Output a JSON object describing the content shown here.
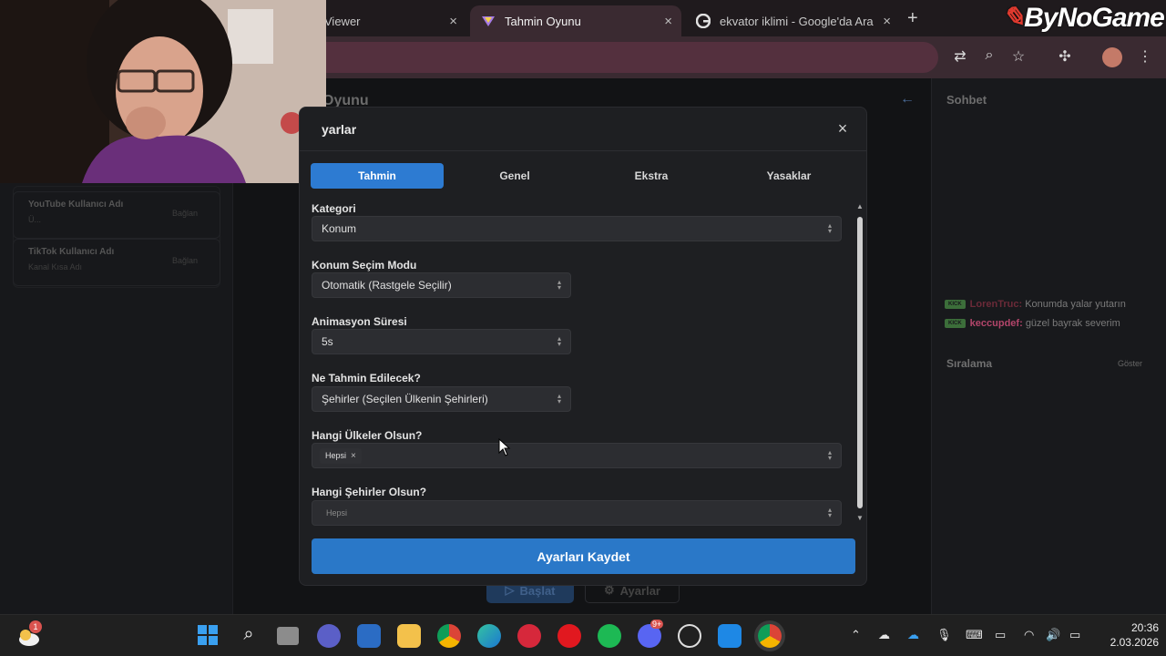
{
  "browser": {
    "tabs": [
      {
        "title": "Viewer",
        "active": false
      },
      {
        "title": "Tahmin Oyunu",
        "active": true
      },
      {
        "title": "ekvator iklimi - Google'da Ara",
        "active": false
      }
    ],
    "new_tab": "+",
    "close_glyph": "×",
    "brand_text": "ByNoGame",
    "toolbar_icons": [
      "translate-icon",
      "zoom-icon",
      "star-icon",
      "extensions-icon",
      "profile-avatar",
      "menu-icon"
    ]
  },
  "page": {
    "title_partial": "Oyunu",
    "cards": [
      {
        "label": "YouTube Kullanıcı Adı",
        "value": "Ü...",
        "action": "Bağlan"
      },
      {
        "label": "TikTok Kullanıcı Adı",
        "value": "Kanal Kısa Adı",
        "action": "Bağlan"
      }
    ],
    "buttons": {
      "start": "Başlat",
      "settings": "Ayarlar"
    }
  },
  "sidebar": {
    "chat_title": "Sohbet",
    "messages": [
      {
        "badge": "KICK",
        "user": "LorenTruc:",
        "text": "Konumda yalar yutarın",
        "user_color": "#6b2a38"
      },
      {
        "badge": "KICK",
        "user": "keccupdef:",
        "text": "güzel bayrak severim",
        "user_color": "#b2456a"
      }
    ],
    "ranking_title": "Sıralama",
    "ranking_show": "Göster"
  },
  "modal": {
    "title": "yarlar",
    "close": "×",
    "tabs": [
      {
        "label": "Tahmin",
        "active": true
      },
      {
        "label": "Genel",
        "active": false
      },
      {
        "label": "Ekstra",
        "active": false
      },
      {
        "label": "Yasaklar",
        "active": false
      }
    ],
    "fields": {
      "kategori": {
        "label": "Kategori",
        "value": "Konum"
      },
      "mode": {
        "label": "Konum Seçim Modu",
        "value": "Otomatik (Rastgele Seçilir)"
      },
      "anim": {
        "label": "Animasyon Süresi",
        "value": "5s"
      },
      "guess": {
        "label": "Ne Tahmin Edilecek?",
        "value": "Şehirler (Seçilen Ülkenin Şehirleri)"
      },
      "countries": {
        "label": "Hangi Ülkeler Olsun?",
        "chip": "Hepsi",
        "chip_remove": "×"
      },
      "cities": {
        "label": "Hangi Şehirler Olsun?",
        "placeholder": "Hepsi"
      }
    },
    "save_label": "Ayarları Kaydet"
  },
  "taskbar": {
    "weather_badge": "1",
    "discord_badge": "9+",
    "time": "20:36",
    "date": "2.03.2026"
  },
  "colors": {
    "accent": "#2d7bd2",
    "save_button": "#2a78c8",
    "modal_bg": "#1e1f22",
    "tab_active_bg": "#3a2a31",
    "kick_green": "#3c6e3a"
  }
}
